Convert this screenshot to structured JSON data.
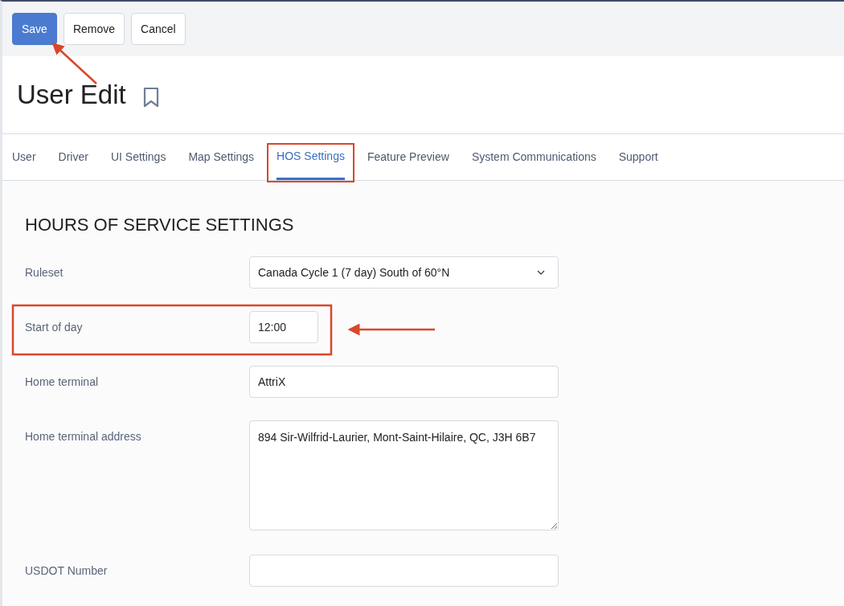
{
  "toolbar": {
    "buttons": [
      {
        "label": "Save",
        "kind": "primary"
      },
      {
        "label": "Remove",
        "kind": "default"
      },
      {
        "label": "Cancel",
        "kind": "default"
      }
    ]
  },
  "page": {
    "title": "User Edit",
    "bookmarked": false
  },
  "tabs": [
    {
      "label": "User",
      "selected": false
    },
    {
      "label": "Driver",
      "selected": false
    },
    {
      "label": "UI Settings",
      "selected": false
    },
    {
      "label": "Map Settings",
      "selected": false
    },
    {
      "label": "HOS Settings",
      "selected": true
    },
    {
      "label": "Feature Preview",
      "selected": false
    },
    {
      "label": "System Communications",
      "selected": false
    },
    {
      "label": "Support",
      "selected": false
    }
  ],
  "section": {
    "heading": "HOURS OF SERVICE SETTINGS",
    "fields": [
      {
        "label": "Ruleset",
        "kind": "select",
        "value": "Canada Cycle 1 (7 day) South of 60°N"
      },
      {
        "label": "Start of day",
        "kind": "time",
        "value": "12:00"
      },
      {
        "label": "Home terminal",
        "kind": "text",
        "value": "AttriX"
      },
      {
        "label": "Home terminal address",
        "kind": "textarea",
        "value": "894 Sir-Wilfrid-Laurier, Mont-Saint-Hilaire, QC, J3H 6B7"
      },
      {
        "label": "USDOT Number",
        "kind": "text"
      }
    ]
  }
}
